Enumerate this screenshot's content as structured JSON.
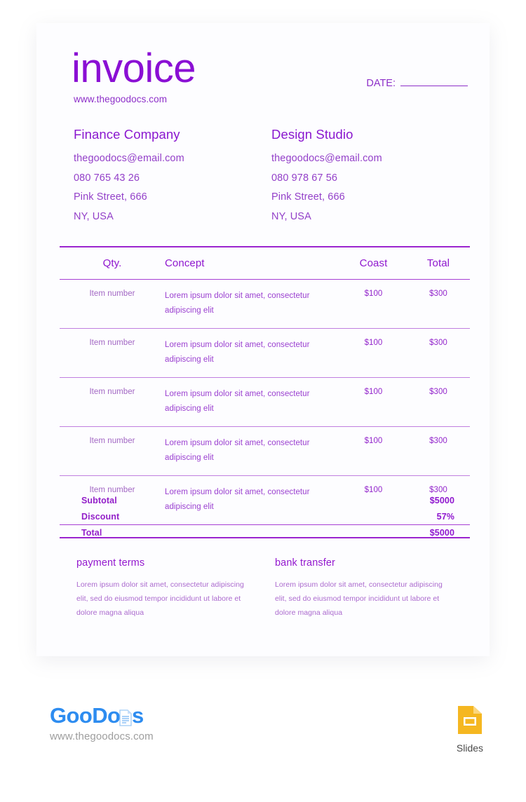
{
  "document": {
    "title": "invoice",
    "website": "www.thegoodocs.com",
    "date_label": "DATE:",
    "date_value": ""
  },
  "parties": [
    {
      "name": "Finance Company",
      "email": "thegoodocs@email.com",
      "phone": "080 765 43 26",
      "street": "Pink Street, 666",
      "city": "NY, USA"
    },
    {
      "name": "Design Studio",
      "email": "thegoodocs@email.com",
      "phone": "080 978 67 56",
      "street": "Pink Street, 666",
      "city": "NY, USA"
    }
  ],
  "table": {
    "headers": {
      "qty": "Qty.",
      "concept": "Concept",
      "coast": "Coast",
      "total": "Total"
    },
    "rows": [
      {
        "qty": "Item number",
        "concept": "Lorem ipsum dolor sit amet, consectetur adipiscing elit",
        "coast": "$100",
        "total": "$300"
      },
      {
        "qty": "Item number",
        "concept": "Lorem ipsum dolor sit amet, consectetur adipiscing elit",
        "coast": "$100",
        "total": "$300"
      },
      {
        "qty": "Item number",
        "concept": "Lorem ipsum dolor sit amet, consectetur adipiscing elit",
        "coast": "$100",
        "total": "$300"
      },
      {
        "qty": "Item number",
        "concept": "Lorem ipsum dolor sit amet, consectetur adipiscing elit",
        "coast": "$100",
        "total": "$300"
      },
      {
        "qty": "Item number",
        "concept": "Lorem ipsum dolor sit amet, consectetur adipiscing elit",
        "coast": "$100",
        "total": "$300"
      }
    ]
  },
  "totals": [
    {
      "label": "Subtotal",
      "value": "$5000"
    },
    {
      "label": "Discount",
      "value": "57%"
    },
    {
      "label": "Total",
      "value": "$5000"
    }
  ],
  "notes": [
    {
      "title": "payment terms",
      "body": "Lorem ipsum dolor sit amet, consectetur adipiscing elit, sed do eiusmod tempor incididunt ut labore et dolore magna aliqua"
    },
    {
      "title": "bank transfer",
      "body": "Lorem ipsum dolor sit amet, consectetur adipiscing elit, sed do eiusmod tempor incididunt ut labore et dolore magna aliqua"
    }
  ],
  "footer": {
    "brand_goo": "Goo",
    "brand_docs": "Docs",
    "brand_url": "www.thegoodocs.com",
    "slides_label": "Slides",
    "slides_icon": "google-slides-icon"
  },
  "colors": {
    "accent": "#8a0fd4",
    "accent_light": "#ab6ace",
    "rule": "#9b24cf",
    "brand_blue": "#2d8cf0",
    "slides_yellow": "#f5b721"
  }
}
